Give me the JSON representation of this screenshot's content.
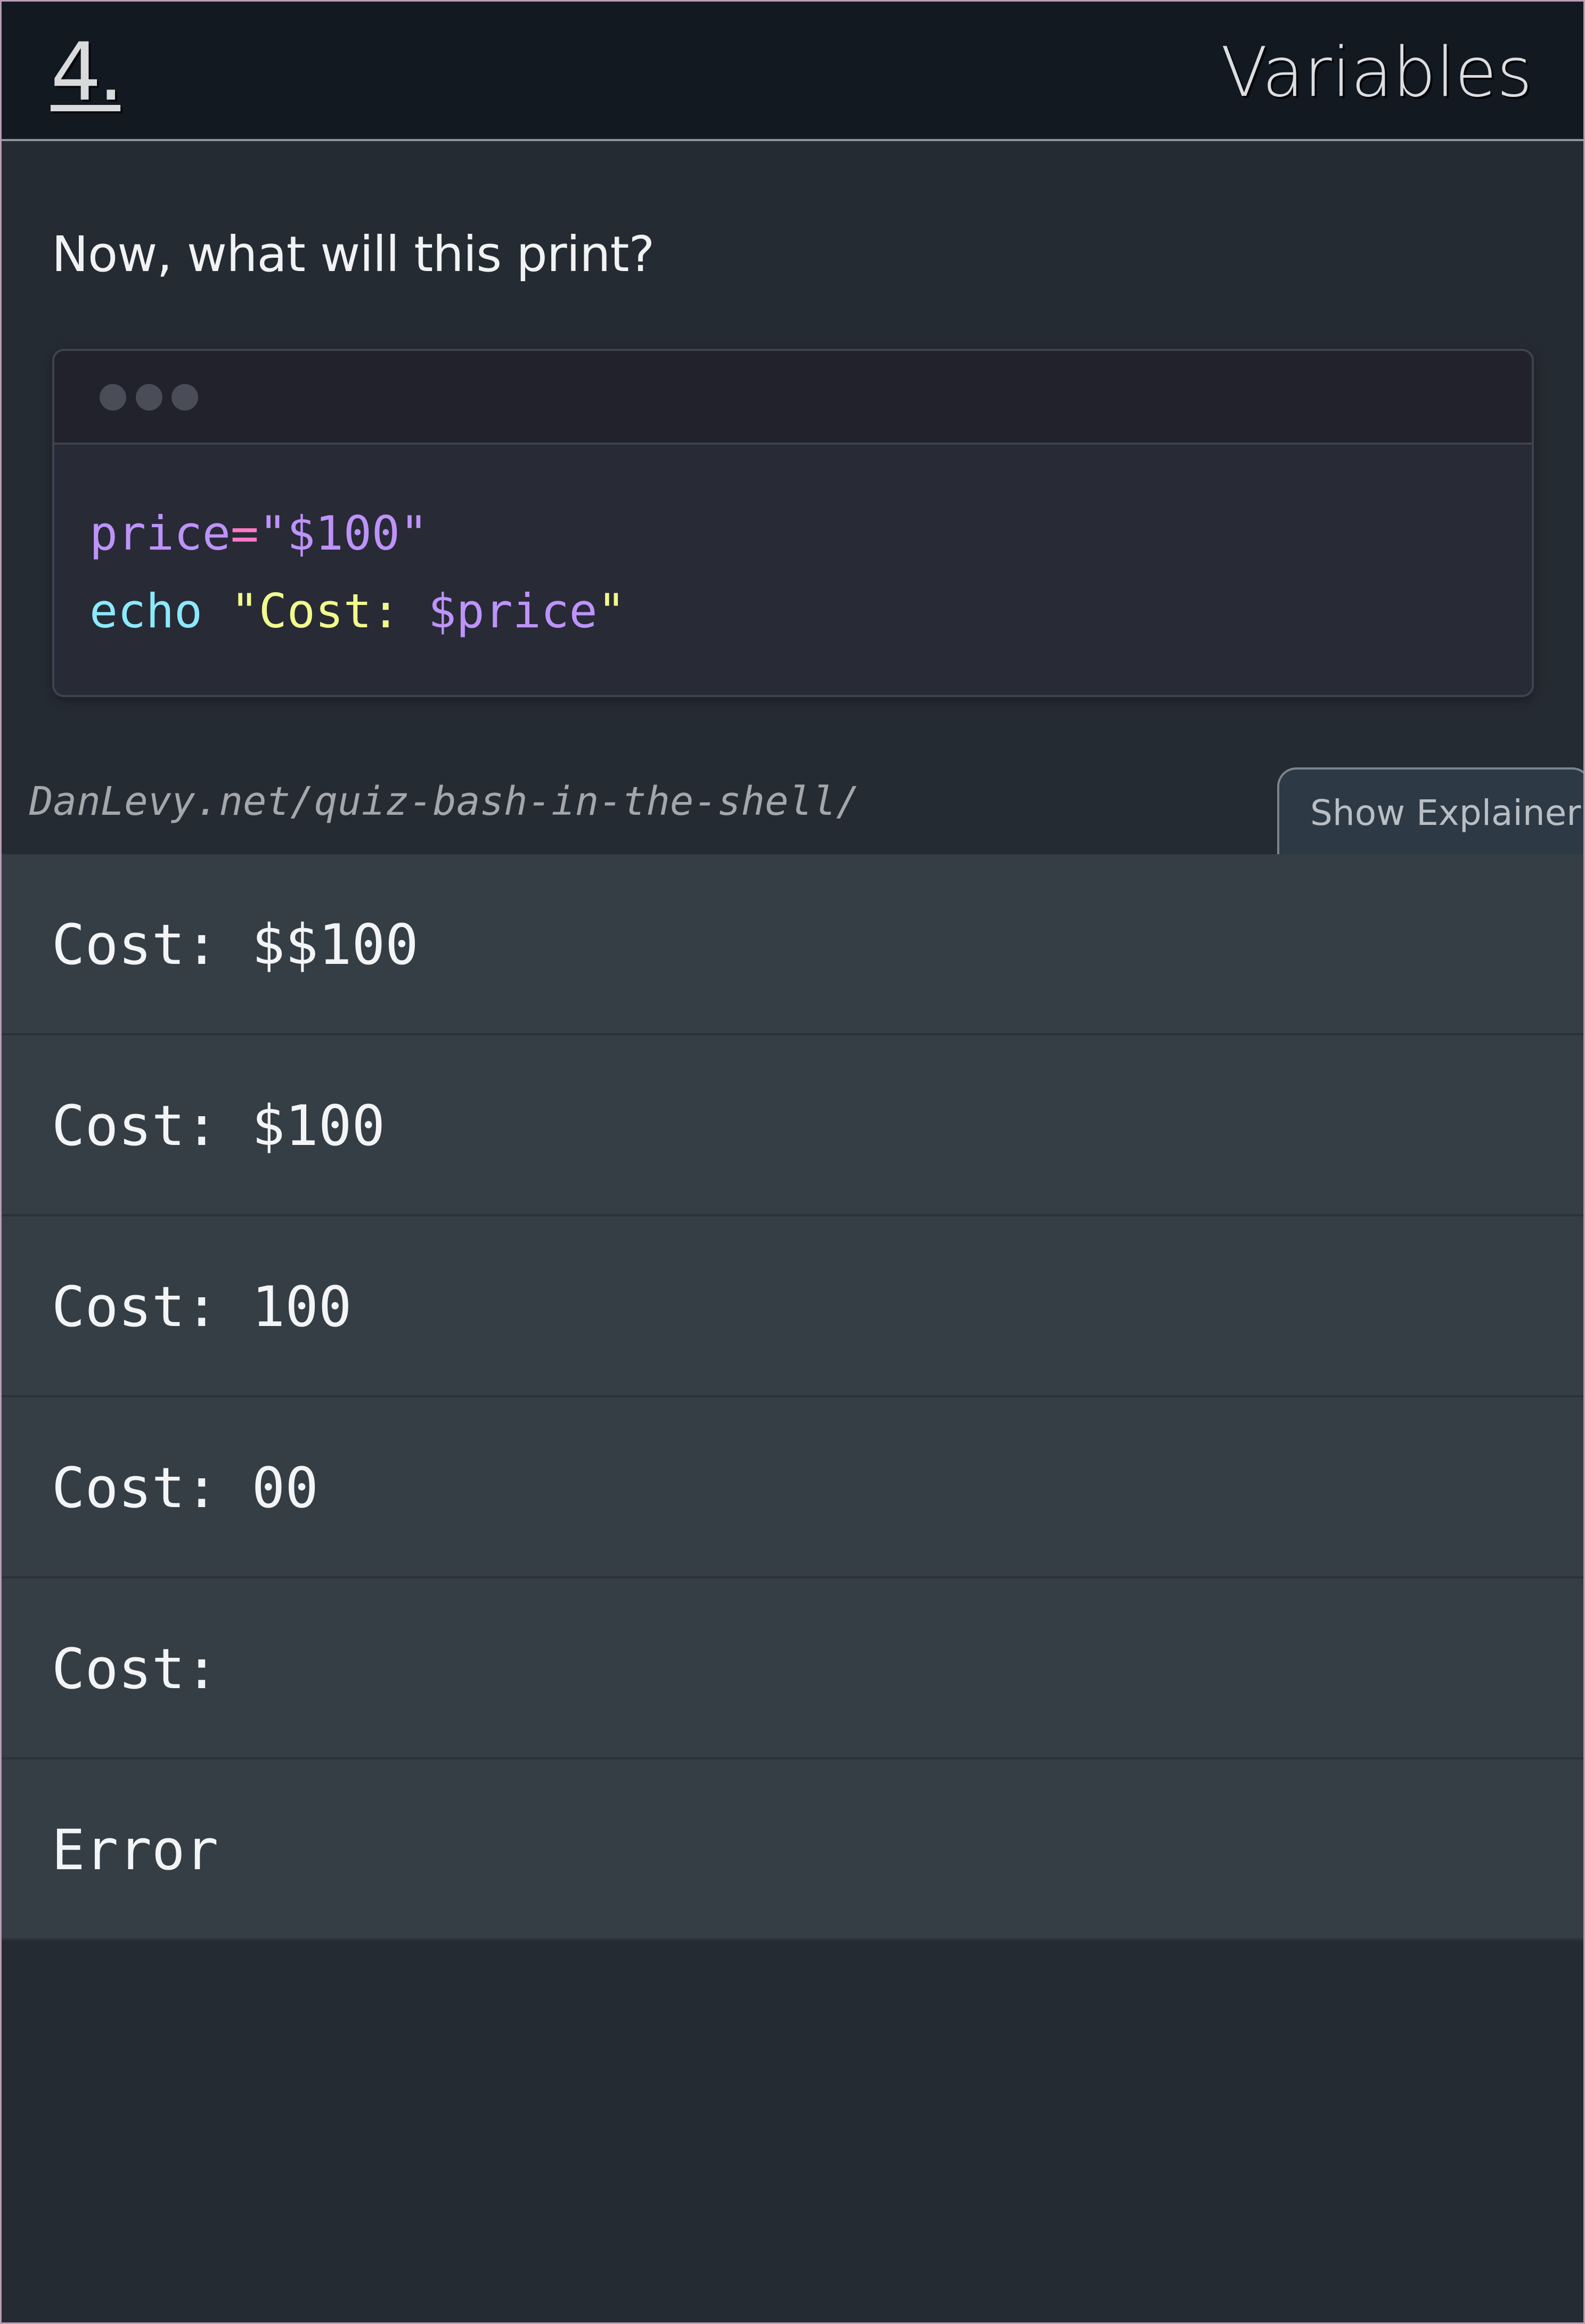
{
  "header": {
    "number": "4.",
    "title": "Variables"
  },
  "prompt": "Now, what will this print?",
  "code_window": {
    "dots": [
      "window-dot",
      "window-dot",
      "window-dot"
    ],
    "lines": [
      [
        {
          "text": "price",
          "color": "#bd93f9"
        },
        {
          "text": "=",
          "color": "#ff79c6"
        },
        {
          "text": "\"$100\"",
          "color": "#bd93f9"
        }
      ],
      [
        {
          "text": "echo",
          "color": "#8be9fd"
        },
        {
          "text": " ",
          "color": "#f8f8f2"
        },
        {
          "text": "\"Cost: ",
          "color": "#f1fa8c"
        },
        {
          "text": "$price",
          "color": "#bd93f9"
        },
        {
          "text": "\"",
          "color": "#f1fa8c"
        }
      ]
    ]
  },
  "source_url": "DanLevy.net/quiz-bash-in-the-shell/",
  "explainer_button": "Show Explainer",
  "answers": [
    "Cost: $$100",
    "Cost: $100",
    "Cost: 100",
    "Cost: 00",
    "Cost:",
    "Error"
  ]
}
